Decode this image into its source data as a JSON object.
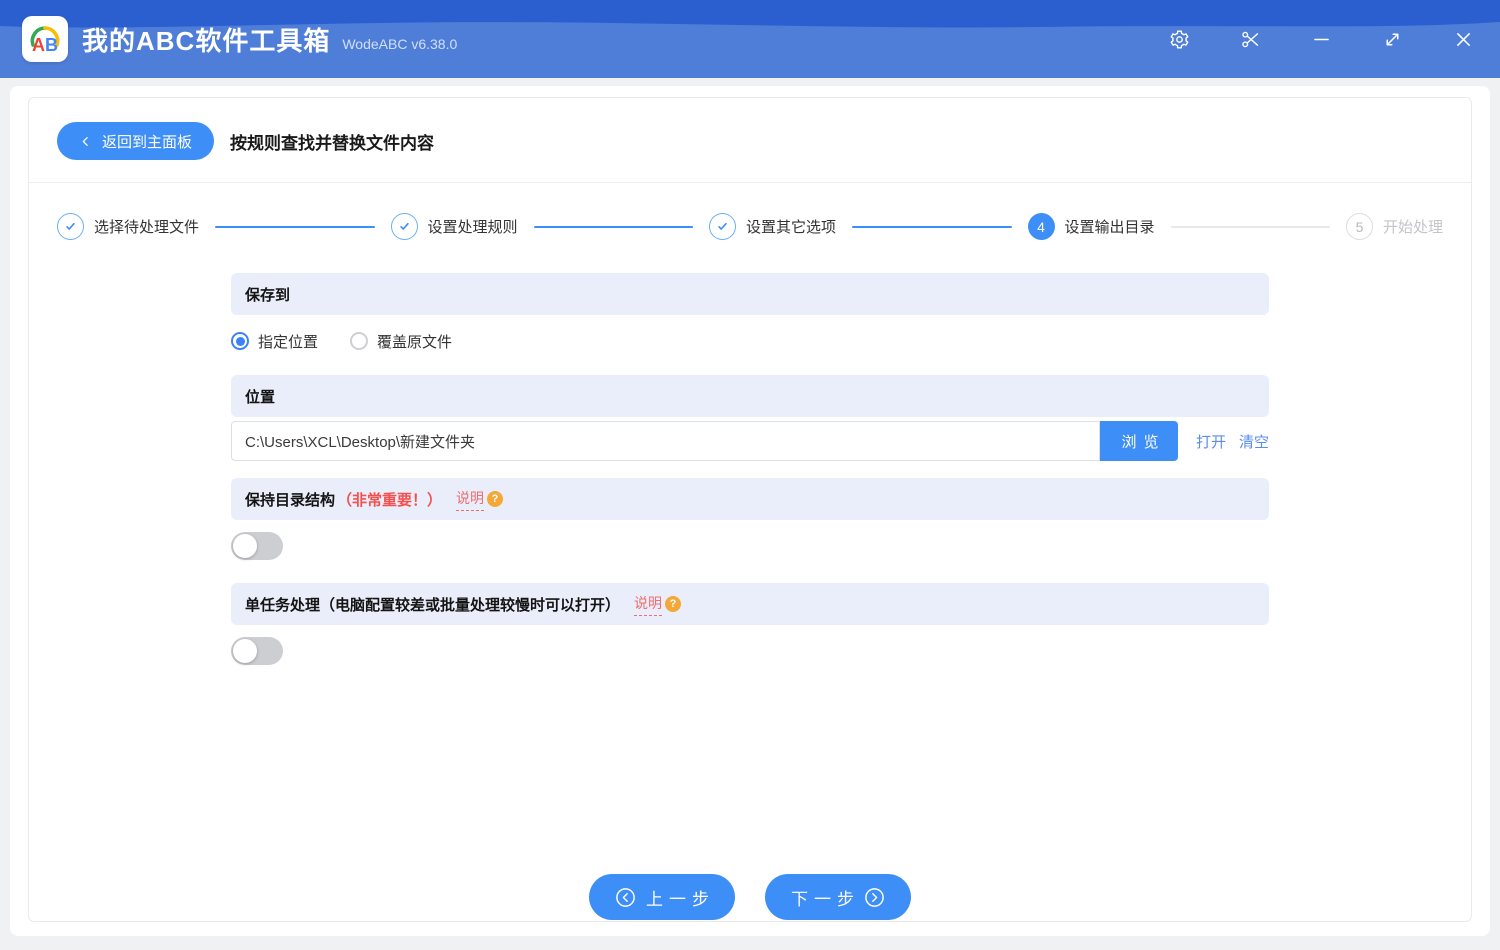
{
  "titlebar": {
    "logo_text": "AB",
    "app_title": "我的ABC软件工具箱",
    "version": "WodeABC v6.38.0"
  },
  "toolbar": {
    "back_label": "返回到主面板",
    "page_title": "按规则查找并替换文件内容"
  },
  "steps": [
    {
      "label": "选择待处理文件",
      "state": "done"
    },
    {
      "label": "设置处理规则",
      "state": "done"
    },
    {
      "label": "设置其它选项",
      "state": "done"
    },
    {
      "label": "设置输出目录",
      "state": "active",
      "number": "4"
    },
    {
      "label": "开始处理",
      "state": "pending",
      "number": "5"
    }
  ],
  "save_to": {
    "header": "保存到",
    "options": [
      {
        "label": "指定位置",
        "selected": true
      },
      {
        "label": "覆盖原文件",
        "selected": false
      }
    ]
  },
  "location": {
    "header": "位置",
    "path": "C:\\Users\\XCL\\Desktop\\新建文件夹",
    "browse_label": "浏览",
    "open_label": "打开",
    "clear_label": "清空"
  },
  "keep_structure": {
    "title": "保持目录结构",
    "warning": "（非常重要！）",
    "help_label": "说明",
    "enabled": false
  },
  "single_task": {
    "title": "单任务处理（电脑配置较差或批量处理较慢时可以打开）",
    "help_label": "说明",
    "enabled": false
  },
  "footer": {
    "prev_label": "上一步",
    "next_label": "下一步"
  },
  "misc": {
    "help_badge_glyph": "?"
  },
  "colors": {
    "accent_blue": "#3e8ef7",
    "header_dark": "#2b5fd0",
    "header_light": "#4f7ed9",
    "bar_bg": "#e9eefa",
    "warning_red": "#f4504f",
    "help_red": "#f16d6d",
    "badge_orange": "#f5a83a",
    "link_blue": "#5b8cee",
    "page_bg": "#f0f1f3"
  }
}
